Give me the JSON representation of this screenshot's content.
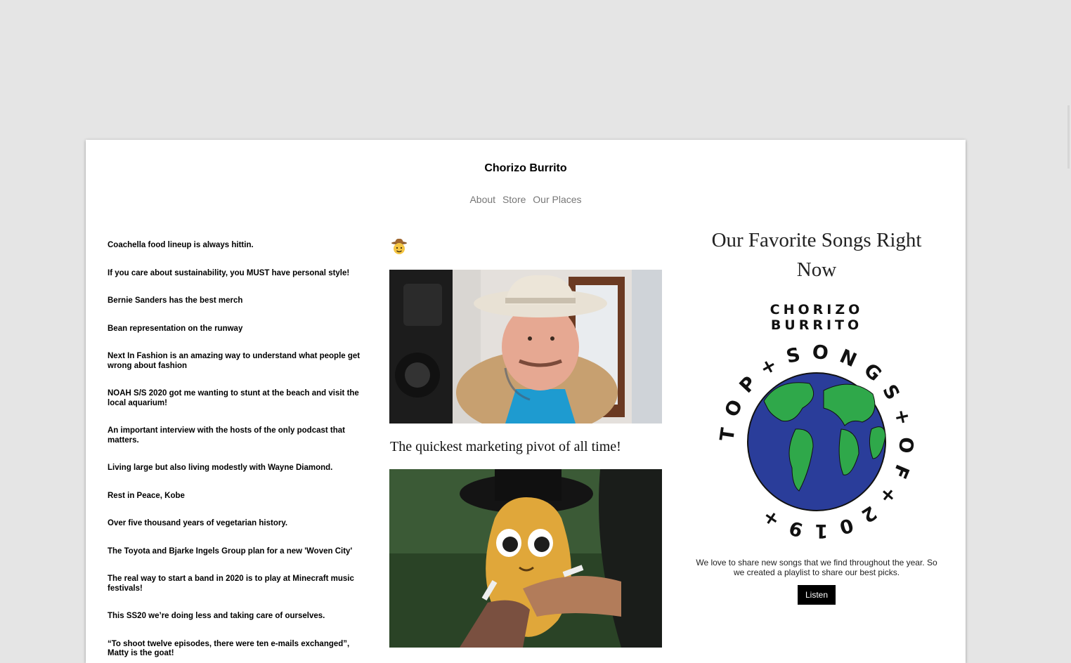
{
  "site": {
    "title": "Chorizo Burrito"
  },
  "nav": {
    "items": [
      "About",
      "Store",
      "Our Places"
    ]
  },
  "articles": [
    "Coachella food lineup is always hittin.",
    "If you care about sustainability, you MUST have personal style!",
    "Bernie Sanders has the best merch",
    "Bean representation on the runway",
    "Next In Fashion is an amazing way to understand what people get wrong about fashion",
    "NOAH S/S 2020 got me wanting to stunt at the beach and visit the local aquarium!",
    "An important interview with the hosts of the only podcast that matters.",
    "Living large but also living modestly with Wayne Diamond.",
    "Rest in Peace, Kobe",
    "Over five thousand years of vegetarian history.",
    "The Toyota and Bjarke Ingels Group plan for a new 'Woven City'",
    "The real way to start a band in 2020 is to play at Minecraft music festivals!",
    "This SS20 we’re doing less and taking care of ourselves.",
    "“To shoot twelve episodes, there were ten e-mails exchanged”, Matty is the goat!"
  ],
  "feed": {
    "emoji": "cowboy-face-icon",
    "post_title": "The quickest marketing pivot of all time!"
  },
  "playlist": {
    "heading": "Our Favorite Songs Right Now",
    "cover_brand_line1": "CHORIZO",
    "cover_brand_line2": "BURRITO",
    "cover_ring_text": "TOP+SONGS+OF+2019+",
    "blurb": "We love to share new songs that we find throughout the year. So we created a playlist to share our best picks.",
    "button": "Listen"
  },
  "colors": {
    "page_bg": "#e5e5e5",
    "ocean": "#2a3d9a",
    "land": "#2fa84a",
    "button_bg": "#000000"
  }
}
